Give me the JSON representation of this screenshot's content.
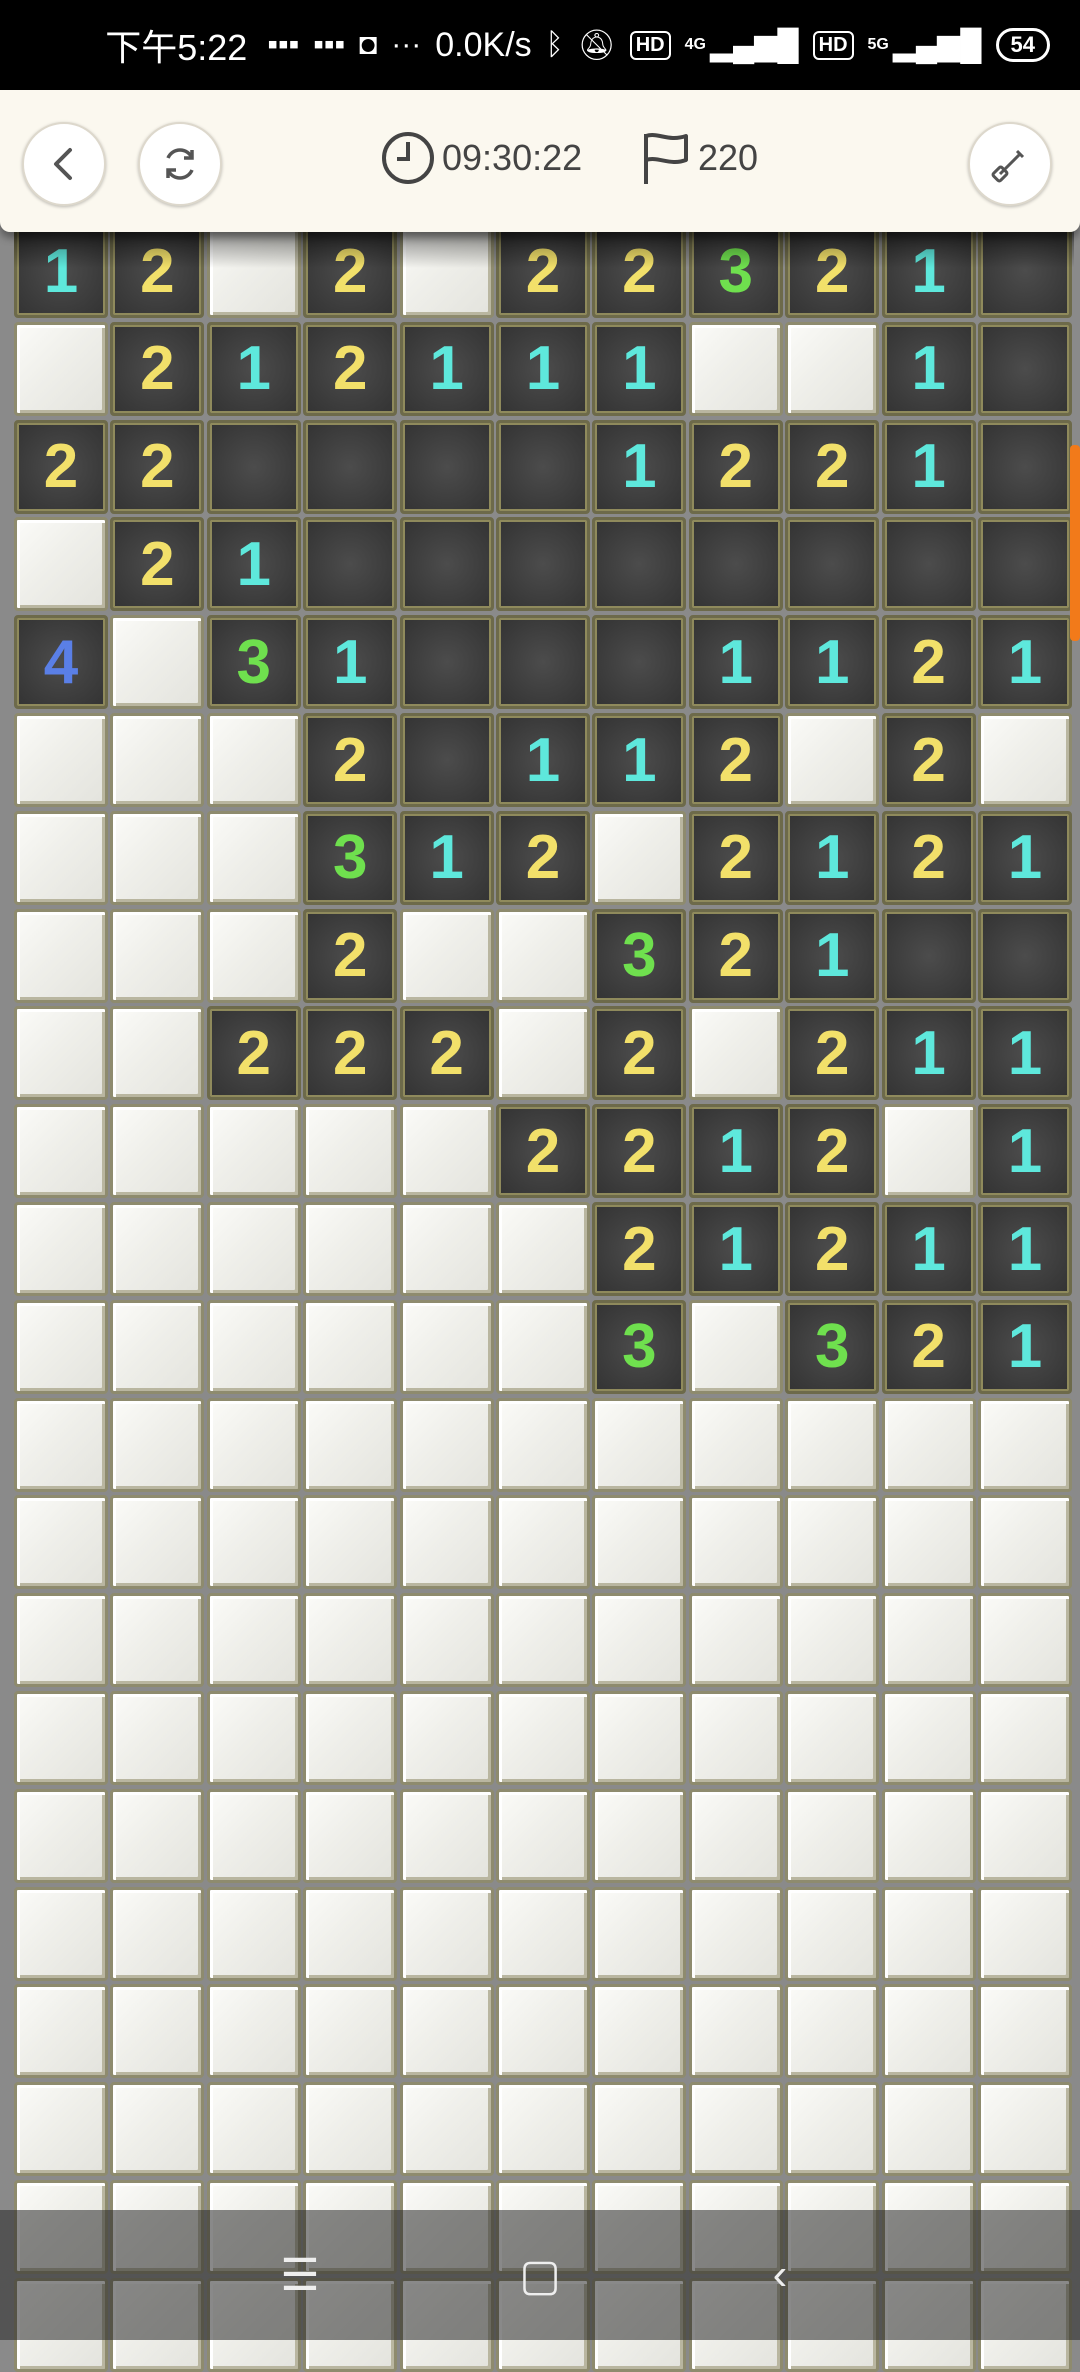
{
  "status_bar": {
    "time": "下午5:22",
    "net_speed": "0.0K/s",
    "net_4g": "4G",
    "net_5g": "5G",
    "hd": "HD",
    "battery": "54",
    "icons": [
      "message-icon",
      "message-icon",
      "mi-icon",
      "more-icon",
      "bluetooth-icon",
      "mute-bell-icon",
      "signal-icon",
      "signal-icon"
    ]
  },
  "toolbar": {
    "timer": "09:30:22",
    "flags": "220",
    "icons": {
      "back": "back-arrow-icon",
      "refresh": "refresh-icon",
      "clock": "clock-icon",
      "flag": "flag-icon",
      "tool": "shovel-icon"
    }
  },
  "board": {
    "columns": 11,
    "note": "Rows top to bottom. c = closed cell, o = open empty, digits = revealed number.",
    "rows": [
      [
        "1",
        "2",
        "c",
        "2",
        "c",
        "2",
        "2",
        "3",
        "2",
        "1",
        "o"
      ],
      [
        "c",
        "2",
        "1",
        "2",
        "1",
        "1",
        "1",
        "c",
        "c",
        "1",
        "o"
      ],
      [
        "2",
        "2",
        "o",
        "o",
        "o",
        "o",
        "1",
        "2",
        "2",
        "1",
        "o"
      ],
      [
        "c",
        "2",
        "1",
        "o",
        "o",
        "o",
        "o",
        "o",
        "o",
        "o",
        "o"
      ],
      [
        "4",
        "c",
        "3",
        "1",
        "o",
        "o",
        "o",
        "1",
        "1",
        "2",
        "1"
      ],
      [
        "c",
        "c",
        "c",
        "2",
        "o",
        "1",
        "1",
        "2",
        "c",
        "2",
        "c"
      ],
      [
        "c",
        "c",
        "c",
        "3",
        "1",
        "2",
        "c",
        "2",
        "1",
        "2",
        "1"
      ],
      [
        "c",
        "c",
        "c",
        "2",
        "c",
        "c",
        "3",
        "2",
        "1",
        "o",
        "o"
      ],
      [
        "c",
        "c",
        "2",
        "2",
        "2",
        "c",
        "2",
        "c",
        "2",
        "1",
        "1"
      ],
      [
        "c",
        "c",
        "c",
        "c",
        "c",
        "2",
        "2",
        "1",
        "2",
        "c",
        "1"
      ],
      [
        "c",
        "c",
        "c",
        "c",
        "c",
        "c",
        "2",
        "1",
        "2",
        "1",
        "1"
      ],
      [
        "c",
        "c",
        "c",
        "c",
        "c",
        "c",
        "3",
        "c",
        "3",
        "2",
        "1"
      ],
      [
        "c",
        "c",
        "c",
        "c",
        "c",
        "c",
        "c",
        "c",
        "c",
        "c",
        "c"
      ],
      [
        "c",
        "c",
        "c",
        "c",
        "c",
        "c",
        "c",
        "c",
        "c",
        "c",
        "c"
      ],
      [
        "c",
        "c",
        "c",
        "c",
        "c",
        "c",
        "c",
        "c",
        "c",
        "c",
        "c"
      ],
      [
        "c",
        "c",
        "c",
        "c",
        "c",
        "c",
        "c",
        "c",
        "c",
        "c",
        "c"
      ],
      [
        "c",
        "c",
        "c",
        "c",
        "c",
        "c",
        "c",
        "c",
        "c",
        "c",
        "c"
      ],
      [
        "c",
        "c",
        "c",
        "c",
        "c",
        "c",
        "c",
        "c",
        "c",
        "c",
        "c"
      ],
      [
        "c",
        "c",
        "c",
        "c",
        "c",
        "c",
        "c",
        "c",
        "c",
        "c",
        "c"
      ],
      [
        "c",
        "c",
        "c",
        "c",
        "c",
        "c",
        "c",
        "c",
        "c",
        "c",
        "c"
      ],
      [
        "c",
        "c",
        "c",
        "c",
        "c",
        "c",
        "c",
        "c",
        "c",
        "c",
        "c"
      ],
      [
        "c",
        "c",
        "c",
        "c",
        "c",
        "c",
        "c",
        "c",
        "c",
        "c",
        "c"
      ]
    ]
  },
  "nav_bar": {
    "icons": [
      "menu-icon",
      "home-icon",
      "back-icon"
    ]
  },
  "colors": {
    "n1": "#5ee8dc",
    "n2": "#f2e06a",
    "n3": "#6fe04e",
    "n4": "#5a7fe6",
    "scroll_indicator": "#f27a1a"
  }
}
